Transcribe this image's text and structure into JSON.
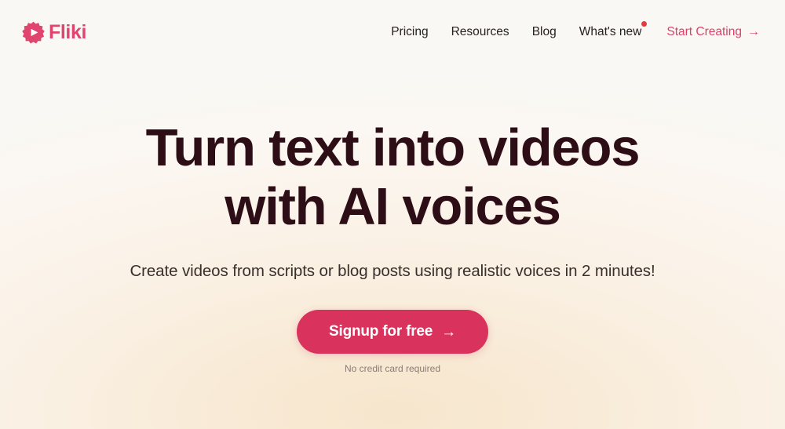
{
  "brand": {
    "name": "Fliki",
    "logo_icon": "fliki-starburst-play-icon",
    "color": "#e0456f"
  },
  "nav": {
    "items": [
      {
        "label": "Pricing",
        "name": "pricing",
        "badge": false
      },
      {
        "label": "Resources",
        "name": "resources",
        "badge": false
      },
      {
        "label": "Blog",
        "name": "blog",
        "badge": false
      },
      {
        "label": "What's new",
        "name": "whats-new",
        "badge": true
      }
    ],
    "cta": {
      "label": "Start Creating",
      "arrow": "→",
      "color": "#da4268"
    },
    "badge_color": "#e33c3c"
  },
  "hero": {
    "title": "Turn text into videos with AI voices",
    "subtitle": "Create videos from scripts or blog posts using realistic voices in 2 minutes!",
    "title_color": "#2d0e16",
    "cta": {
      "label": "Signup for free",
      "arrow": "→",
      "background": "#d8325d",
      "text_color": "#ffffff"
    },
    "note": "No credit card required"
  },
  "background": {
    "base": "#faf8f4",
    "glow_center": "#f7e6cd"
  }
}
